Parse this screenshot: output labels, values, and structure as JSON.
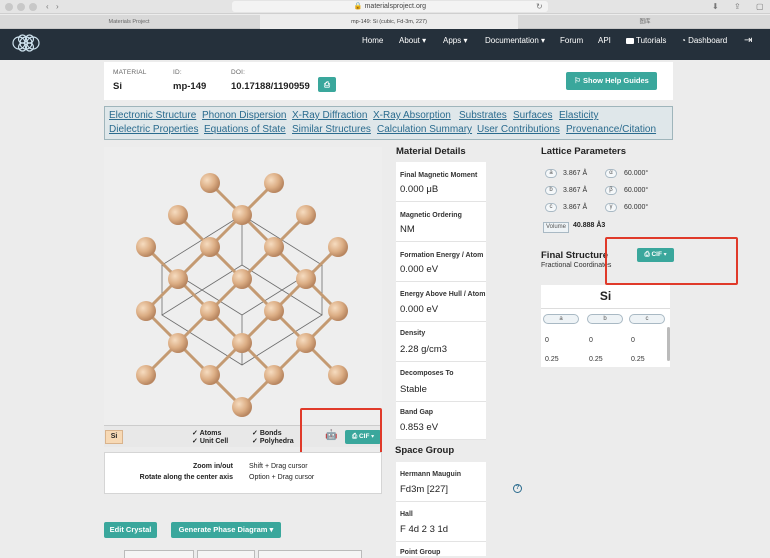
{
  "browser": {
    "url": "materialsproject.org",
    "tabs": [
      "Materials Project",
      "mp-149: Si (cubic, Fd-3m, 227)",
      "图库"
    ]
  },
  "nav": {
    "items": [
      "Home",
      "About",
      "Apps",
      "Documentation",
      "Forum",
      "API",
      "Tutorials",
      "Dashboard"
    ]
  },
  "header": {
    "material_label": "MATERIAL",
    "material": "Si",
    "id_label": "ID:",
    "id": "mp-149",
    "doi_label": "DOI:",
    "doi": "10.17188/1190959",
    "help_button": "Show Help Guides"
  },
  "links": [
    "Electronic Structure",
    "Phonon Dispersion",
    "X-Ray Diffraction",
    "X-Ray Absorption",
    "Substrates",
    "Surfaces",
    "Elasticity",
    "Dielectric Properties",
    "Equations of State",
    "Similar Structures",
    "Calculation Summary",
    "User Contributions",
    "Provenance/Citation"
  ],
  "viewer": {
    "element_tag": "Si",
    "checks": [
      "Atoms",
      "Unit Cell",
      "Bonds",
      "Polyhedra"
    ],
    "cif_button": "CIF",
    "help_rows": [
      {
        "action": "Zoom in/out",
        "control": "Shift + Drag cursor"
      },
      {
        "action": "Rotate along the center axis",
        "control": "Option + Drag cursor"
      }
    ],
    "edit_button": "Edit Crystal",
    "phase_button": "Generate Phase Diagram"
  },
  "details": {
    "title": "Material Details",
    "props": [
      {
        "label": "Final Magnetic Moment",
        "value": "0.000 μB"
      },
      {
        "label": "Magnetic Ordering",
        "value": "NM"
      },
      {
        "label": "Formation Energy / Atom",
        "value": "0.000 eV"
      },
      {
        "label": "Energy Above Hull / Atom",
        "value": "0.000 eV"
      },
      {
        "label": "Density",
        "value": "2.28 g/cm3"
      },
      {
        "label": "Decomposes To",
        "value": "Stable"
      },
      {
        "label": "Band Gap",
        "value": "0.853 eV"
      }
    ],
    "space_group_title": "Space Group",
    "sg_props": [
      {
        "label": "Hermann Mauguin",
        "value": "Fd3m [227]"
      },
      {
        "label": "Hall",
        "value": "F 4d 2 3 1d"
      },
      {
        "label": "Point Group",
        "value": ""
      }
    ]
  },
  "lattice": {
    "title": "Lattice Parameters",
    "rows": [
      {
        "k1": "a",
        "v1": "3.867 Å",
        "k2": "α",
        "v2": "60.000°"
      },
      {
        "k1": "b",
        "v1": "3.867 Å",
        "k2": "β",
        "v2": "60.000°"
      },
      {
        "k1": "c",
        "v1": "3.867 Å",
        "k2": "γ",
        "v2": "60.000°"
      }
    ],
    "volume_label": "Volume",
    "volume": "40.888 Å3"
  },
  "structure": {
    "title": "Final Structure",
    "subtitle": "Fractional Coordinates",
    "cif_button": "CIF",
    "element": "Si",
    "headers": [
      "a",
      "b",
      "c"
    ],
    "rows": [
      [
        "0",
        "0",
        "0"
      ],
      [
        "0.25",
        "0.25",
        "0.25"
      ]
    ]
  },
  "colors": {
    "accent": "#3aa79c",
    "nav": "#25303b",
    "highlight": "#e03a2a",
    "atom": "#deb887"
  }
}
